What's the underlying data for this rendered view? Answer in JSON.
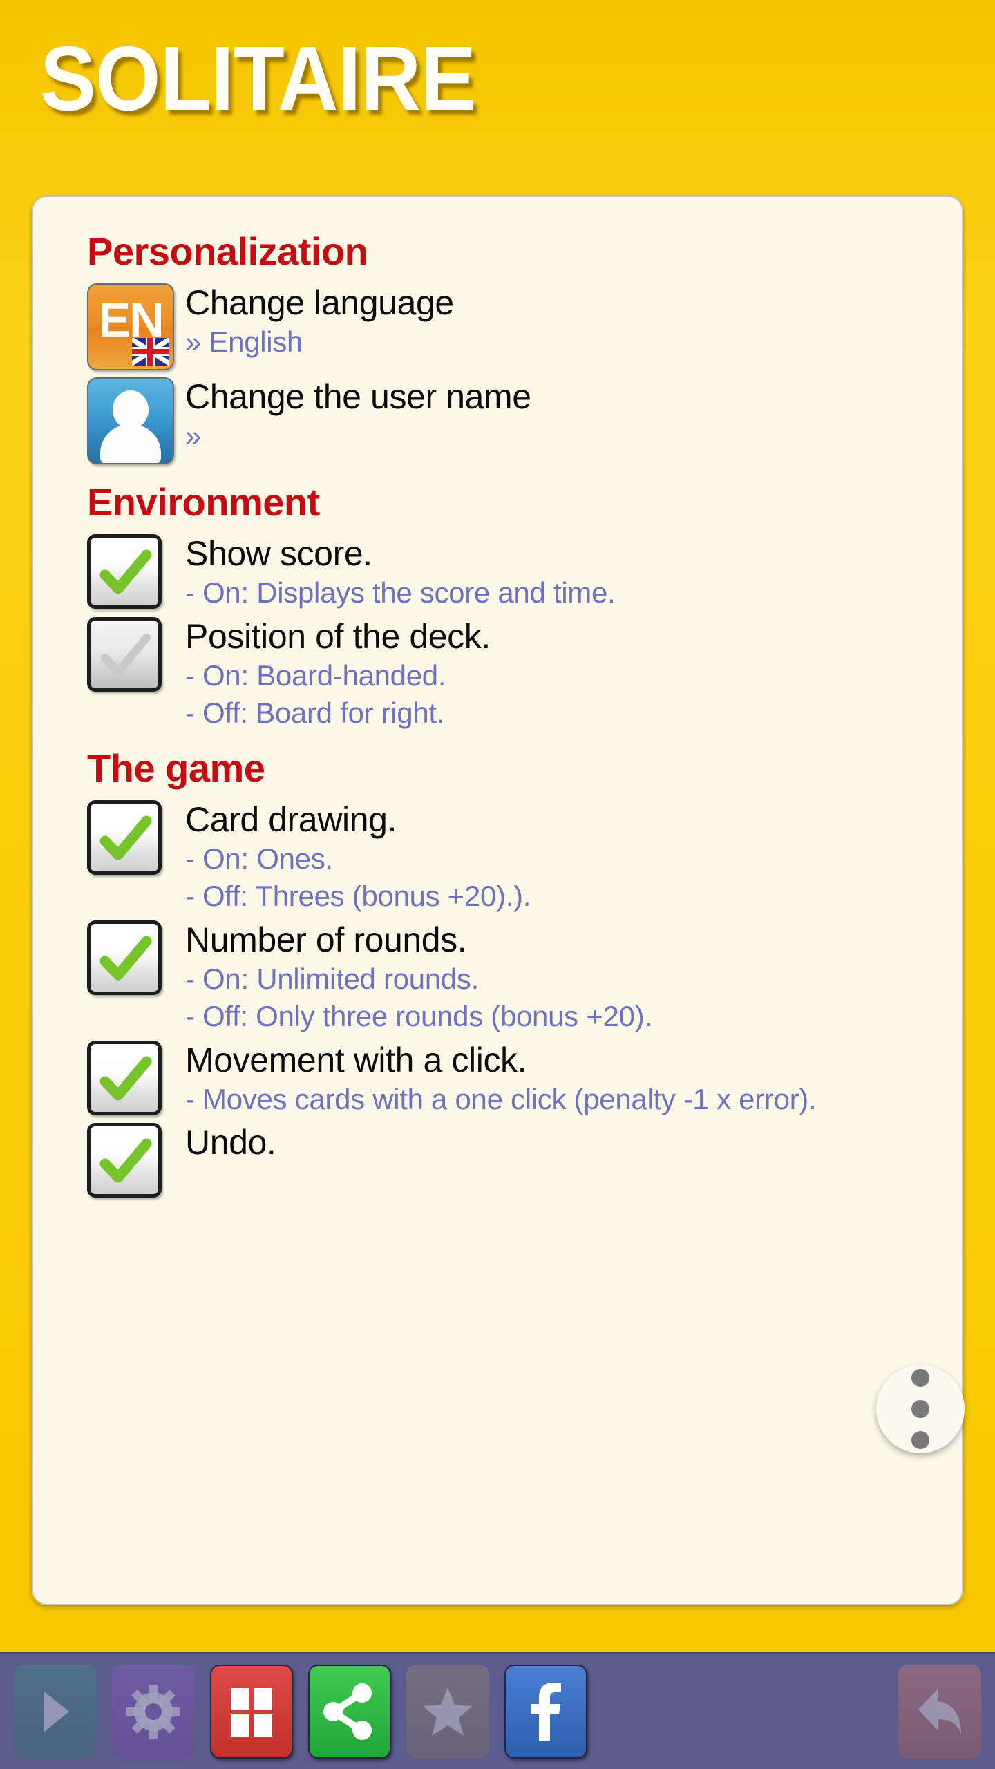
{
  "app": {
    "title": "SOLITAIRE",
    "accent_yellow": "#fbce0c",
    "card_bg": "#fbf8e8",
    "heading_red": "#c40c12",
    "subtext_purple": "#6f70c0",
    "toolbar_bg": "#5c5c8e"
  },
  "sections": [
    {
      "heading": "Personalization",
      "rows": [
        {
          "icon": "language-en-icon",
          "icon_text": "EN",
          "title": "Change language",
          "sub": "» English"
        },
        {
          "icon": "user-avatar-icon",
          "title": "Change the user name",
          "sub": "»"
        }
      ]
    },
    {
      "heading": "Environment",
      "rows": [
        {
          "icon": "checkbox-checked-icon",
          "checked": true,
          "title": "Show score.",
          "sub_lines": [
            "- On: Displays the score and time."
          ]
        },
        {
          "icon": "checkbox-unchecked-icon",
          "checked": false,
          "title": "Position of the deck.",
          "sub_lines": [
            "- On: Board-handed.",
            "- Off: Board for right."
          ]
        }
      ]
    },
    {
      "heading": "The game",
      "rows": [
        {
          "icon": "checkbox-checked-icon",
          "checked": true,
          "title": "Card drawing.",
          "sub_lines": [
            "- On: Ones.",
            "- Off: Threes (bonus +20).)."
          ]
        },
        {
          "icon": "checkbox-checked-icon",
          "checked": true,
          "title": "Number of rounds.",
          "sub_lines": [
            "- On: Unlimited rounds.",
            "- Off: Only three rounds (bonus +20)."
          ]
        },
        {
          "icon": "checkbox-checked-icon",
          "checked": true,
          "title": "Movement with a click.",
          "sub_lines": [
            "- Moves cards with a one click (penalty -1 x error)."
          ]
        },
        {
          "icon": "checkbox-checked-icon",
          "checked": true,
          "title": "Undo.",
          "sub_lines": []
        }
      ]
    }
  ],
  "fab": {
    "name": "overflow-menu-button",
    "dots": 3
  },
  "toolbar": {
    "buttons": [
      {
        "name": "play-button",
        "icon": "play-icon",
        "state": "dim"
      },
      {
        "name": "settings-button",
        "icon": "gear-icon",
        "state": "dim"
      },
      {
        "name": "cards-button",
        "icon": "grid-icon",
        "state": "active"
      },
      {
        "name": "share-button",
        "icon": "share-icon",
        "state": "active"
      },
      {
        "name": "rate-button",
        "icon": "star-icon",
        "state": "dim"
      },
      {
        "name": "facebook-button",
        "icon": "facebook-icon",
        "state": "active"
      },
      {
        "name": "back-button",
        "icon": "back-arrow-icon",
        "state": "dim"
      }
    ]
  }
}
